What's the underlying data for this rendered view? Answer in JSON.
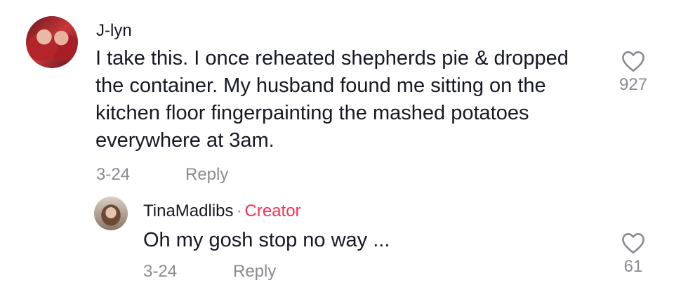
{
  "comment": {
    "author": "J-lyn",
    "text": "I take this. I once reheated shepherds pie & dropped the container. My husband found me sitting on the kitchen floor fingerpainting the mashed potatoes everywhere at 3am.",
    "date": "3-24",
    "reply_label": "Reply",
    "like_count": "927",
    "like_icon": "heart-outline-icon"
  },
  "reply": {
    "author": "TinaMadlibs",
    "separator": "·",
    "badge": "Creator",
    "badge_color": "#fe2c55",
    "text": "Oh my gosh stop no way ...",
    "date": "3-24",
    "reply_label": "Reply",
    "like_count": "61",
    "like_icon": "heart-outline-icon"
  }
}
